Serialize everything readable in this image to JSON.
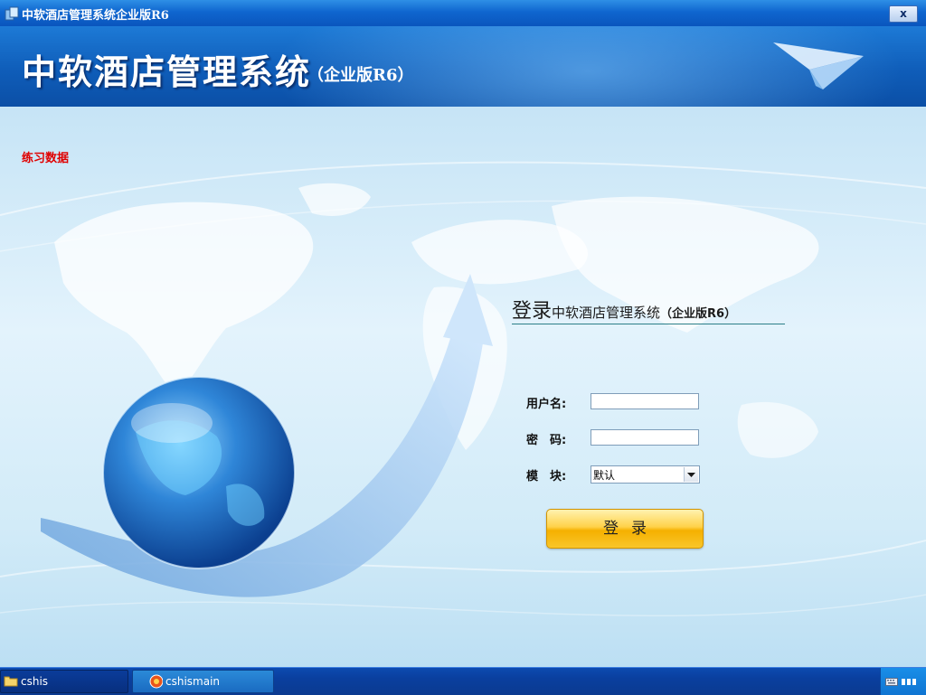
{
  "window": {
    "title": "中软酒店管理系统企业版R6",
    "close_label": "x"
  },
  "banner": {
    "title": "中软酒店管理系统",
    "subtitle": "（企业版R6）"
  },
  "main": {
    "practice_label": "练习数据"
  },
  "login": {
    "heading_word": "登录",
    "heading_system": "中软酒店管理系统",
    "heading_edition": "（企业版R6）",
    "username_label": "用户名:",
    "password_label": "密　码:",
    "module_label": "模　块:",
    "username_value": "",
    "password_value": "",
    "module_selected": "默认",
    "button_label": "登录"
  },
  "taskbar": {
    "items": [
      {
        "label": "cshis",
        "icon": "folder-icon"
      },
      {
        "label": "cshismain",
        "icon": "app-icon"
      }
    ],
    "tray_icons": [
      "keyboard-icon",
      "tray-dots-icon"
    ]
  },
  "colors": {
    "practice_label": "#e00000",
    "titlebar": "#0f66cf",
    "login_button": "#ffd24a"
  }
}
